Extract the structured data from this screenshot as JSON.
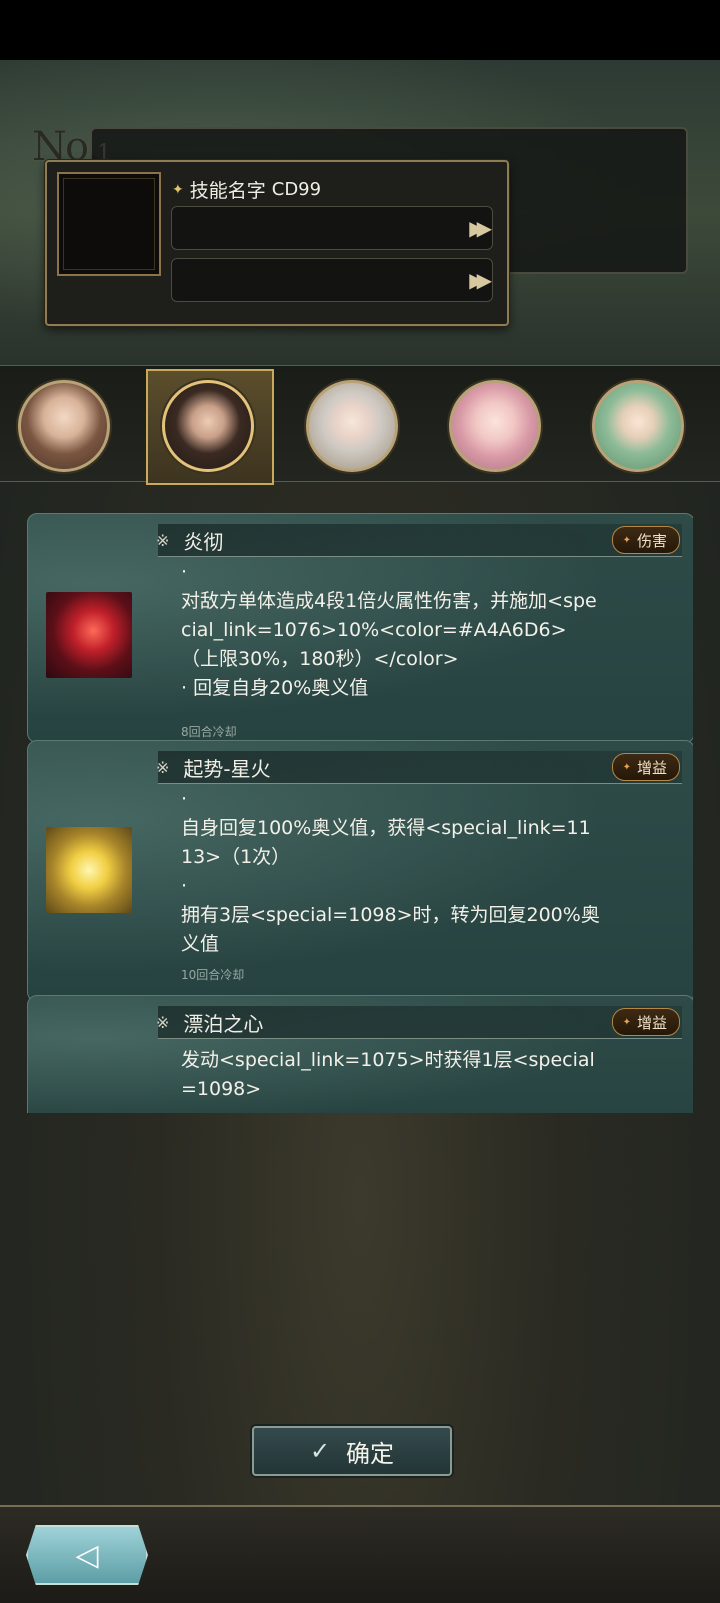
{
  "header": {
    "no_prefix": "No.",
    "no_number": "1"
  },
  "skill_preview": {
    "title_star": "✦",
    "title": "技能名字",
    "cd": "CD99",
    "field_arrow": "▶▶"
  },
  "avatars": [
    {
      "name": "avatar-1",
      "selected": false
    },
    {
      "name": "avatar-2",
      "selected": true
    },
    {
      "name": "avatar-3",
      "selected": false
    },
    {
      "name": "avatar-4",
      "selected": false
    },
    {
      "name": "avatar-5",
      "selected": false
    }
  ],
  "skills": [
    {
      "mark": "※",
      "title": "炎彻",
      "tag": "伤害",
      "tag_icon": "✦",
      "lines": [
        "·",
        "对敌方单体造成4段1倍火属性伤害，并施加<special_link=1076>10%<color=#A4A6D6>（上限30%，180秒）</color>",
        "· 回复自身20%奥义值"
      ],
      "cooldown": "8回合冷却",
      "icon": "fire-sword-icon"
    },
    {
      "mark": "※",
      "title": "起势-星火",
      "tag": "增益",
      "tag_icon": "✦",
      "lines": [
        "·",
        "自身回复100%奥义值，获得<special_link=1113>（1次）",
        "·",
        "拥有3层<special=1098>时，转为回复200%奥义值"
      ],
      "cooldown": "10回合冷却",
      "icon": "golden-warrior-icon"
    },
    {
      "mark": "※",
      "title": "漂泊之心",
      "tag": "增益",
      "tag_icon": "✦",
      "lines": [
        "发动<special_link=1075>时获得1层<special=1098>"
      ]
    }
  ],
  "confirm_button": {
    "check": "✓",
    "label": "确定"
  },
  "back_button": {
    "arrow": "◁"
  }
}
